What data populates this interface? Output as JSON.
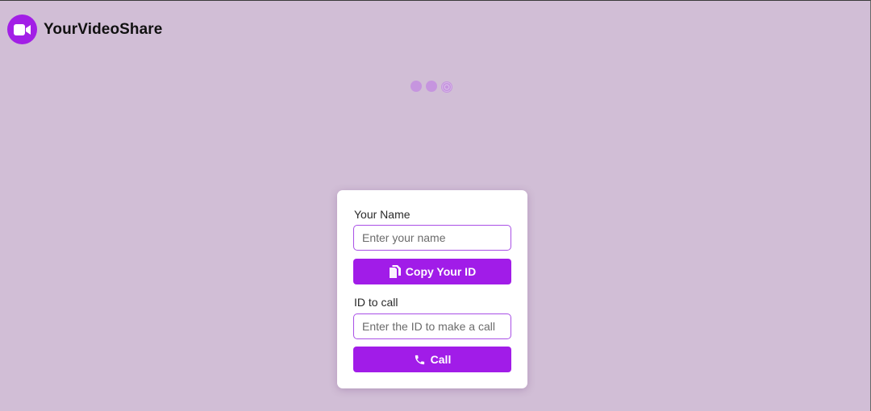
{
  "header": {
    "brand_name": "YourVideoShare",
    "logo_icon": "video-camera-icon",
    "accent_color": "#a21fe6"
  },
  "form": {
    "name_label": "Your Name",
    "name_placeholder": "Enter your name",
    "name_value": "",
    "copy_button_label": "Copy Your ID",
    "copy_icon": "copy-document-icon",
    "id_label": "ID to call",
    "id_placeholder": "Enter the ID to make a call",
    "id_value": "",
    "call_button_label": "Call",
    "call_icon": "phone-icon",
    "button_color": "#a11ce8"
  },
  "loader": {
    "icon": "loading-dots-icon"
  }
}
